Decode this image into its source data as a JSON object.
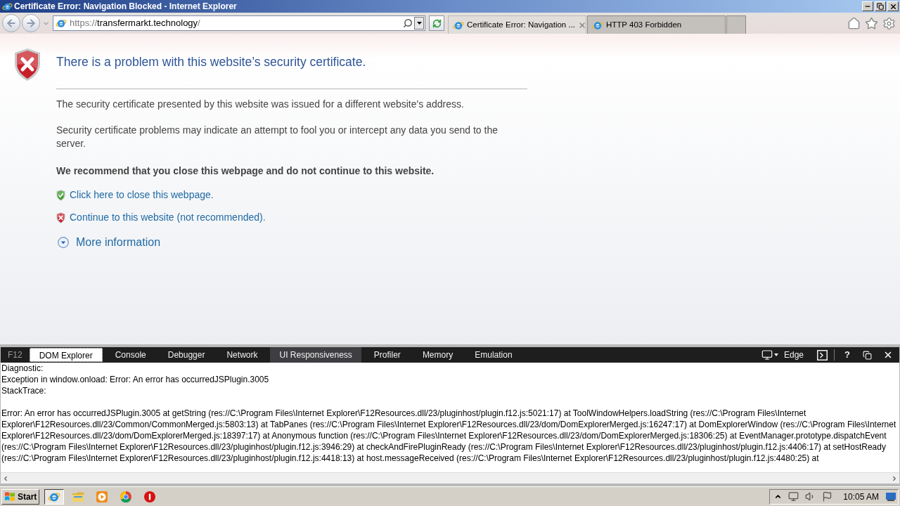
{
  "window": {
    "title": "Certificate Error: Navigation Blocked - Internet Explorer"
  },
  "toolbar": {
    "address": {
      "scheme": "https://",
      "host": "transfermarkt.technology",
      "path": "/"
    }
  },
  "tabs": [
    {
      "title": "Certificate Error: Navigation ...",
      "selected": true
    },
    {
      "title": "HTTP 403 Forbidden",
      "selected": false
    }
  ],
  "page": {
    "heading": "There is a problem with this website’s security certificate.",
    "paragraphs": [
      "The security certificate presented by this website was issued for a different website's address.",
      "Security certificate problems may indicate an attempt to fool you or intercept any data you send to the server."
    ],
    "recommendation": "We recommend that you close this webpage and do not continue to this website.",
    "links": [
      {
        "kind": "safe",
        "label": "Click here to close this webpage."
      },
      {
        "kind": "unsafe",
        "label": "Continue to this website (not recommended)."
      }
    ],
    "more_info": {
      "label": "More information",
      "expanded": false
    }
  },
  "devtools": {
    "badge": "F12",
    "tabs": [
      {
        "label": "DOM Explorer",
        "selected": true,
        "hovered": false
      },
      {
        "label": "Console",
        "selected": false,
        "hovered": false
      },
      {
        "label": "Debugger",
        "selected": false,
        "hovered": false
      },
      {
        "label": "Network",
        "selected": false,
        "hovered": false
      },
      {
        "label": "UI Responsiveness",
        "selected": false,
        "hovered": true
      },
      {
        "label": "Profiler",
        "selected": false,
        "hovered": false
      },
      {
        "label": "Memory",
        "selected": false,
        "hovered": false
      },
      {
        "label": "Emulation",
        "selected": false,
        "hovered": false
      }
    ],
    "mode": "Edge",
    "help": "?",
    "console": {
      "header_lines": [
        "Diagnostic:",
        "Exception in window.onload: Error: An error has occurredJSPlugin.3005",
        "StackTrace:"
      ],
      "error_lines": [
        "Error: An error has occurredJSPlugin.3005 at getString (res://C:\\Program Files\\Internet Explorer\\F12Resources.dll/23/pluginhost/plugin.f12.js:5021:17) at ToolWindowHelpers.loadString (res://C:\\Program Files\\Internet",
        "Explorer\\F12Resources.dll/23/Common/CommonMerged.js:5803:13) at TabPanes (res://C:\\Program Files\\Internet Explorer\\F12Resources.dll/23/dom/DomExplorerMerged.js:16247:17) at DomExplorerWindow (res://C:\\Program Files\\Internet",
        "Explorer\\F12Resources.dll/23/dom/DomExplorerMerged.js:18397:17) at Anonymous function (res://C:\\Program Files\\Internet Explorer\\F12Resources.dll/23/dom/DomExplorerMerged.js:18306:25) at EventManager.prototype.dispatchEvent",
        "(res://C:\\Program Files\\Internet Explorer\\F12Resources.dll/23/pluginhost/plugin.f12.js:3946:29) at checkAndFirePluginReady (res://C:\\Program Files\\Internet Explorer\\F12Resources.dll/23/pluginhost/plugin.f12.js:4406:17) at setHostReady",
        "(res://C:\\Program Files\\Internet Explorer\\F12Resources.dll/23/pluginhost/plugin.f12.js:4418:13) at host.messageReceived (res://C:\\Program Files\\Internet Explorer\\F12Resources.dll/23/pluginhost/plugin.f12.js:4480:25) at"
      ]
    }
  },
  "taskbar": {
    "start": "Start",
    "apps": [
      {
        "kind": "browser",
        "selected": true
      },
      {
        "kind": "folder",
        "selected": false
      },
      {
        "kind": "player",
        "selected": false
      },
      {
        "kind": "wheel",
        "selected": false
      },
      {
        "kind": "stop",
        "selected": false
      }
    ],
    "clock": "10:05 AM"
  }
}
